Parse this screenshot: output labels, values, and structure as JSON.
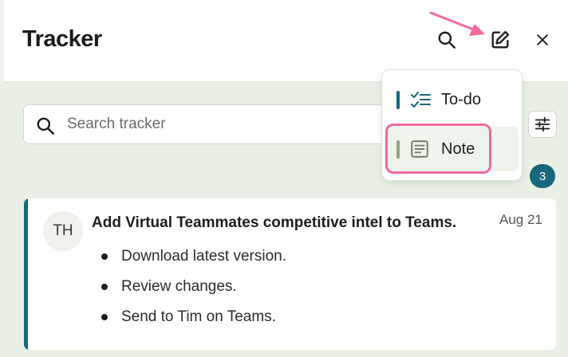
{
  "header": {
    "title": "Tracker",
    "search_icon": "search-icon",
    "compose_icon": "compose-icon",
    "close_icon": "close-icon"
  },
  "search": {
    "placeholder": "Search tracker",
    "value": ""
  },
  "filter": {
    "icon": "filter-sliders-icon"
  },
  "badge": {
    "count": "3"
  },
  "new_menu": {
    "items": [
      {
        "label": "To-do",
        "icon": "checklist-icon",
        "accent": "#17677e"
      },
      {
        "label": "Note",
        "icon": "note-icon",
        "accent": "#8ea67f",
        "highlighted": true
      }
    ]
  },
  "tracker_items": [
    {
      "initials": "TH",
      "title": "Add Virtual Teammates competitive intel to Teams.",
      "date": "Aug 21",
      "bullets": [
        "Download latest version.",
        "Review changes.",
        "Send to Tim on Teams."
      ]
    }
  ],
  "colors": {
    "accent": "#17677e",
    "background": "#e9f1e6",
    "annotation": "#f26aa0"
  }
}
